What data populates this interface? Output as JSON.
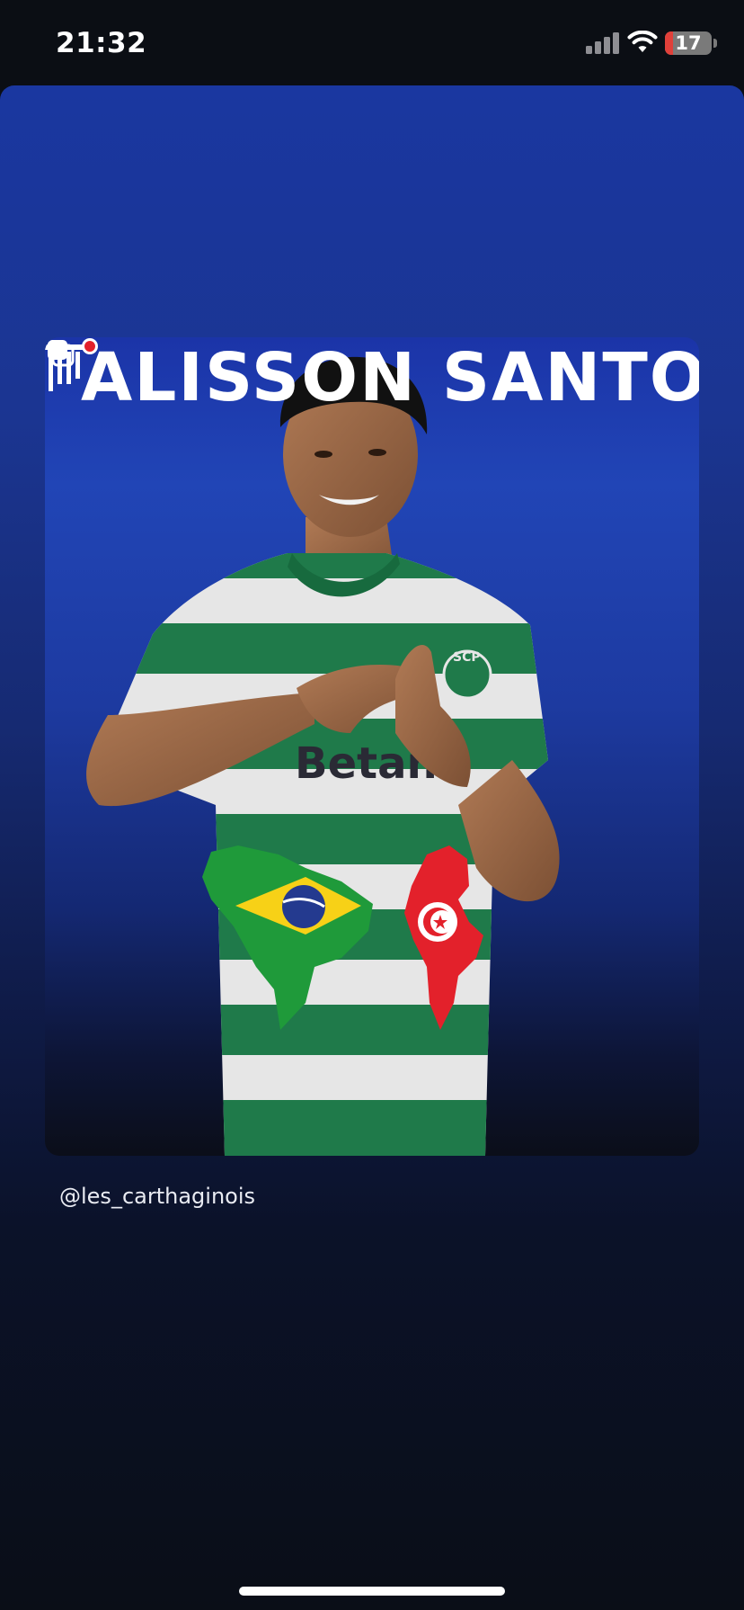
{
  "status_bar": {
    "time": "21:32",
    "battery_level": "17",
    "battery_fraction": 0.17,
    "signal_icon": "cellular-signal-icon",
    "wifi_icon": "wifi-icon"
  },
  "post": {
    "title": "ALISSON SANTOS",
    "copy_icon": "copy-icon",
    "sponsor_text": "Betano",
    "crest_text": "SCP",
    "logo_icon": "carthaginois-column-logo-icon",
    "flags": [
      "brazil-map-flag-icon",
      "tunisia-map-flag-icon"
    ]
  },
  "caption": {
    "handle": "@les_carthaginois"
  },
  "colors": {
    "background": "#0b0e14",
    "story_blue": "#1a37a0",
    "jersey_green": "#1f7a4a",
    "brazil_green": "#1f9a3a",
    "tunisia_red": "#e3212b"
  }
}
